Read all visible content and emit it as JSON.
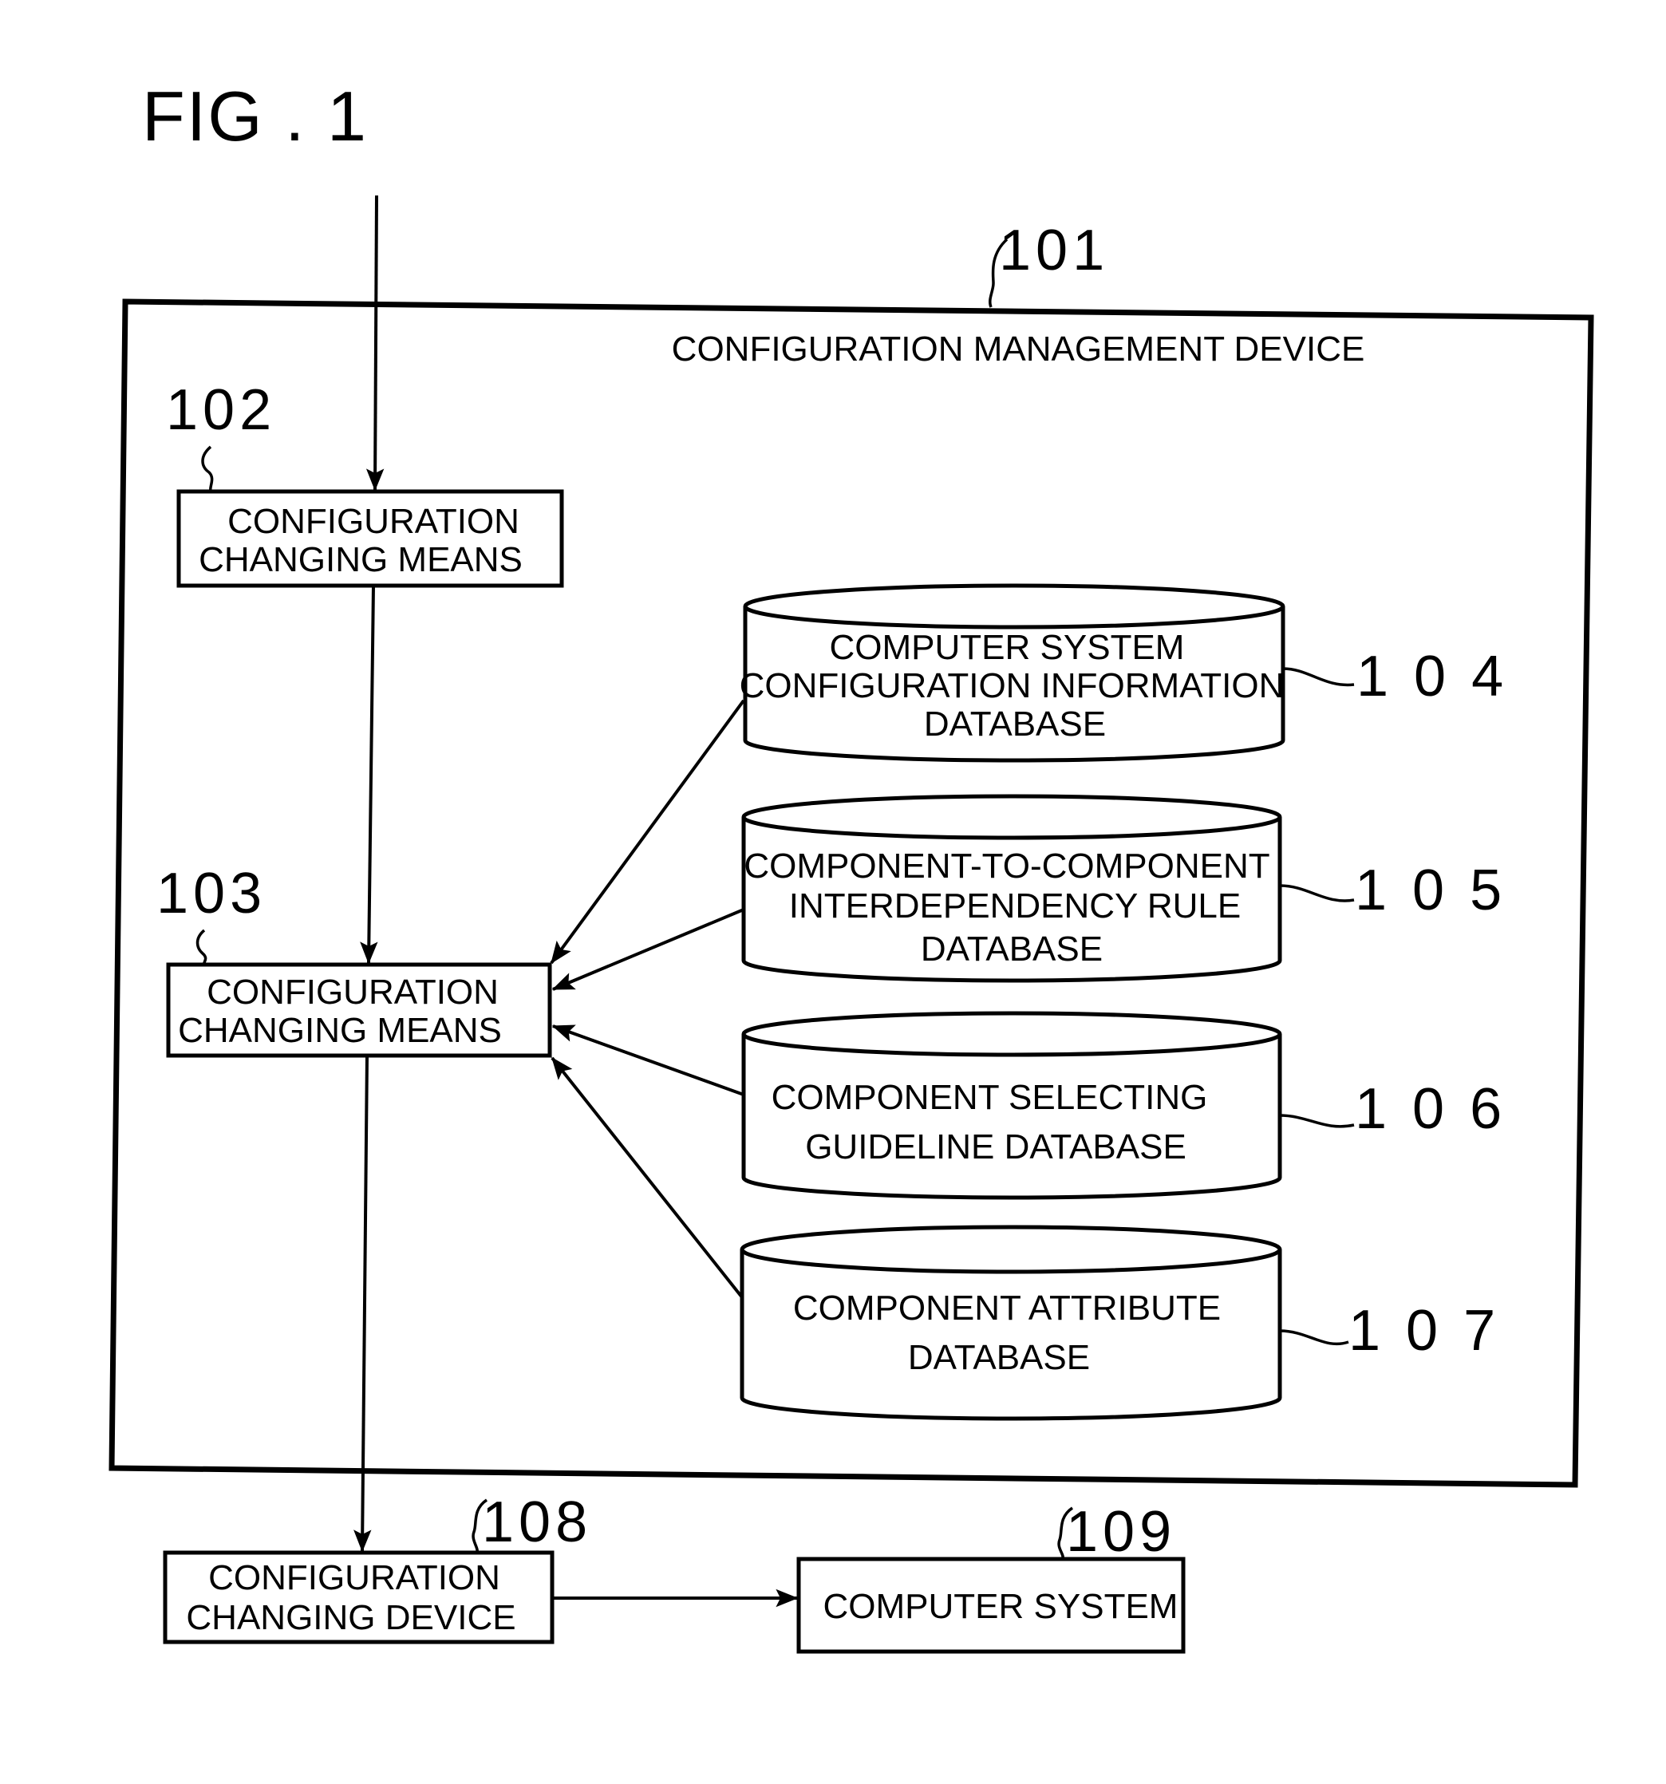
{
  "figure": {
    "title": "FIG . 1"
  },
  "outer_device": {
    "ref": "101",
    "label": "CONFIGURATION MANAGEMENT DEVICE"
  },
  "blocks": [
    {
      "id": "102",
      "ref": "102",
      "lines": [
        "CONFIGURATION",
        "CHANGING MEANS"
      ]
    },
    {
      "id": "103",
      "ref": "103",
      "lines": [
        "CONFIGURATION",
        "CHANGING MEANS"
      ]
    },
    {
      "id": "108",
      "ref": "108",
      "lines": [
        "CONFIGURATION",
        "CHANGING DEVICE"
      ]
    },
    {
      "id": "109",
      "ref": "109",
      "lines": [
        "COMPUTER SYSTEM"
      ]
    }
  ],
  "databases": [
    {
      "id": "104",
      "ref": "1 0 4",
      "lines": [
        "COMPUTER SYSTEM",
        "CONFIGURATION INFORMATION",
        "DATABASE"
      ]
    },
    {
      "id": "105",
      "ref": "1 0 5",
      "lines": [
        "COMPONENT-TO-COMPONENT",
        "INTERDEPENDENCY RULE",
        "DATABASE"
      ]
    },
    {
      "id": "106",
      "ref": "1 0 6",
      "lines": [
        "COMPONENT SELECTING",
        "GUIDELINE DATABASE"
      ]
    },
    {
      "id": "107",
      "ref": "1 0 7",
      "lines": [
        "COMPONENT ATTRIBUTE",
        "DATABASE"
      ]
    }
  ],
  "connections": [
    {
      "from": "external-input",
      "to": "102"
    },
    {
      "from": "102",
      "to": "103"
    },
    {
      "from": "104",
      "to": "103"
    },
    {
      "from": "105",
      "to": "103"
    },
    {
      "from": "106",
      "to": "103"
    },
    {
      "from": "107",
      "to": "103"
    },
    {
      "from": "103",
      "to": "108"
    },
    {
      "from": "108",
      "to": "109"
    }
  ]
}
